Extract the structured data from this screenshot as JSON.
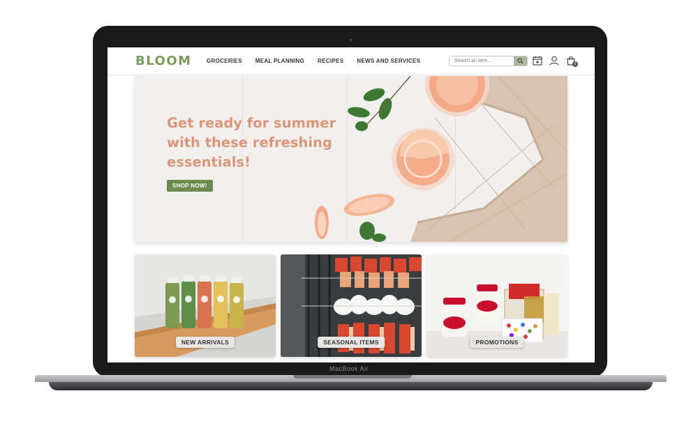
{
  "device": {
    "label": "MacBook Air"
  },
  "nav": {
    "logo": "BLOOM",
    "menu": [
      {
        "label": "GROCERIES"
      },
      {
        "label": "MEAL PLANNING"
      },
      {
        "label": "RECIPES"
      },
      {
        "label": "NEWS AND SERVICES"
      }
    ],
    "search": {
      "placeholder": "Search an item...",
      "value": ""
    },
    "cart_count": "0",
    "icons": [
      "search-icon",
      "calendar-icon",
      "user-icon",
      "shopping-bag-icon"
    ]
  },
  "hero": {
    "title": "Get ready for summer with these refreshing essentials!",
    "button_label": "SHOP NOW!"
  },
  "categories": [
    {
      "label": "NEW ARRIVALS"
    },
    {
      "label": "SEASONAL ITEMS"
    },
    {
      "label": "PROMOTIONS"
    }
  ],
  "colors": {
    "brand_green": "#7b9a5c",
    "button_green": "#6e8a4d",
    "hero_text": "#d99679"
  }
}
